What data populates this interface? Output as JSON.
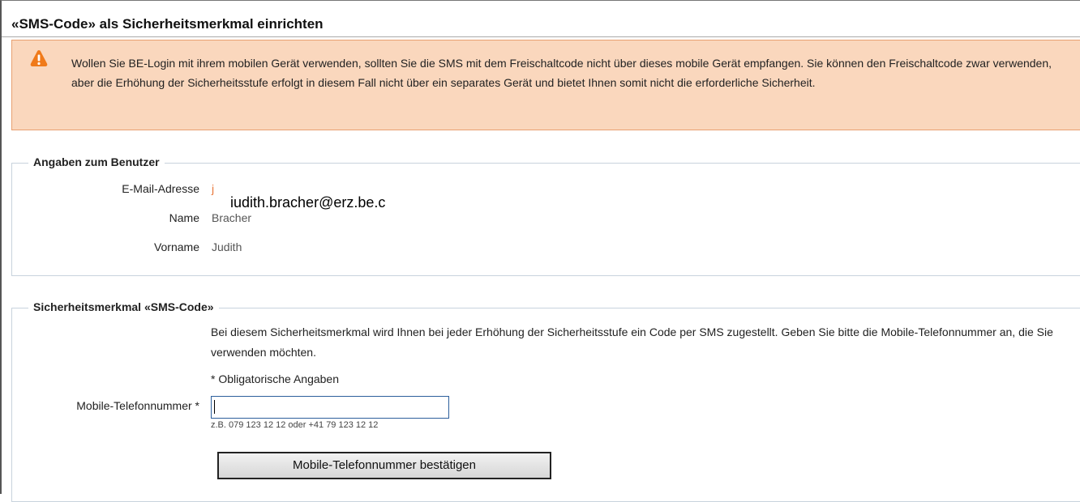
{
  "page": {
    "title": "«SMS-Code» als Sicherheitsmerkmal einrichten"
  },
  "alert": {
    "icon": "warning-icon",
    "color": "#fad7bd",
    "text": "Wollen Sie BE-Login mit ihrem mobilen Gerät verwenden, sollten Sie die SMS mit dem Freischaltcode nicht über dieses mobile Gerät empfangen. Sie können den Freischaltcode zwar verwenden, aber die Erhöhung der Sicherheitsstufe erfolgt in diesem Fall nicht über ein separates Gerät und bietet Ihnen somit nicht die erforderliche Sicherheit."
  },
  "user_section": {
    "legend": "Angaben zum Benutzer",
    "email_label": "E-Mail-Adresse",
    "email_value": "j",
    "email_overlay": "iudith.bracher@erz.be.c",
    "name_label": "Name",
    "name_value": "Bracher",
    "firstname_label": "Vorname",
    "firstname_value": "Judith"
  },
  "sms_section": {
    "legend": "Sicherheitsmerkmal «SMS-Code»",
    "description": "Bei diesem Sicherheitsmerkmal wird Ihnen bei jeder Erhöhung der Sicherheitsstufe ein Code per SMS zugestellt. Geben Sie bitte die Mobile-Telefonnummer an, die Sie verwenden möchten.",
    "required_note": "* Obligatorische Angaben",
    "phone_label": "Mobile-Telefonnummer *",
    "phone_value": "",
    "phone_placeholder": "",
    "phone_hint": "z.B. 079 123 12 12 oder +41 79 123 12 12",
    "submit_label": "Mobile-Telefonnummer bestätigen"
  }
}
